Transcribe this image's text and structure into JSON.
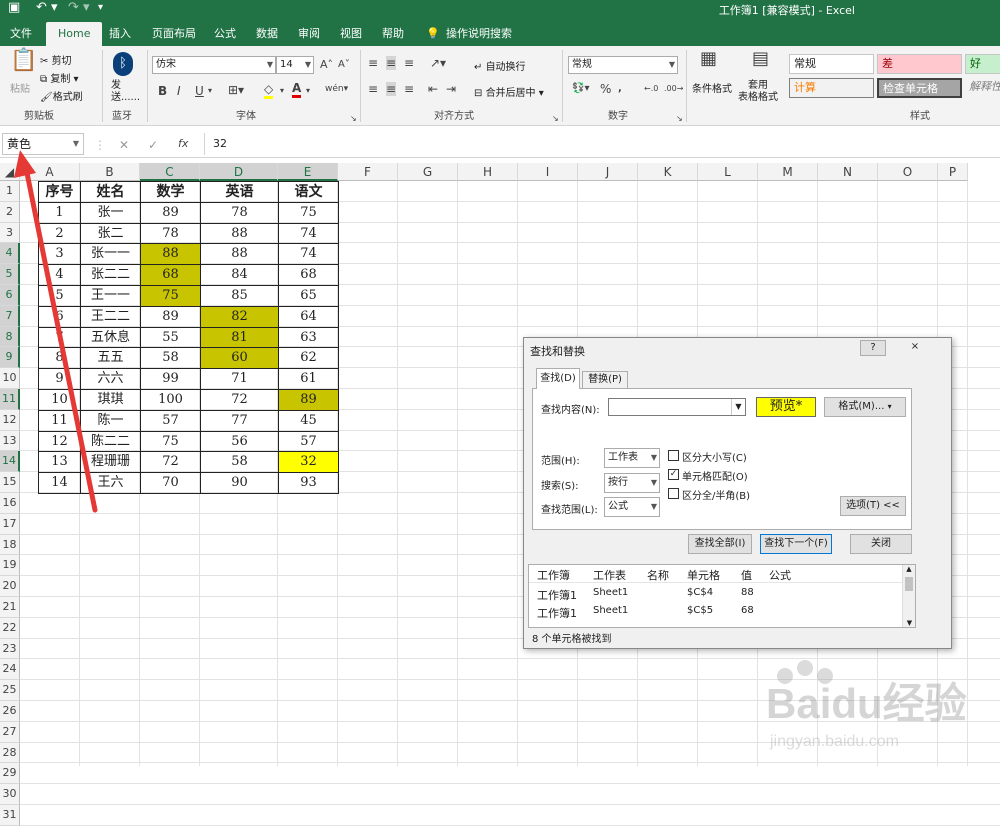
{
  "window": {
    "title": "工作簿1 [兼容模式] - Excel"
  },
  "tabs": [
    "文件",
    "Home",
    "插入",
    "页面布局",
    "公式",
    "数据",
    "审阅",
    "视图",
    "帮助",
    "操作说明搜索"
  ],
  "ribbon": {
    "clipboard": {
      "paste": "粘贴",
      "cut": "剪切",
      "copy": "复制",
      "format_painter": "格式刷",
      "label": "剪贴板"
    },
    "bluetooth": {
      "send": "发送......",
      "label": "蓝牙"
    },
    "font": {
      "name": "仿宋",
      "size": "14",
      "label": "字体"
    },
    "align": {
      "wrap": "自动换行",
      "merge": "合并后居中",
      "label": "对齐方式"
    },
    "number": {
      "format": "常规",
      "label": "数字"
    },
    "styles": {
      "cond": "条件格式",
      "table": "套用\n表格格式",
      "normal": "常规",
      "bad": "差",
      "good": "好",
      "calc": "计算",
      "check": "检查单元格",
      "explain": "解释性",
      "label": "样式"
    }
  },
  "formula_bar": {
    "name_box": "黄色",
    "value": "32"
  },
  "columns": [
    "A",
    "B",
    "C",
    "D",
    "E",
    "F",
    "G",
    "H",
    "I",
    "J",
    "K",
    "L",
    "M",
    "N",
    "O",
    "P"
  ],
  "rows": [
    "1",
    "2",
    "3",
    "4",
    "5",
    "6",
    "7",
    "8",
    "9",
    "10",
    "11",
    "12",
    "13",
    "14",
    "15",
    "16",
    "17",
    "18",
    "19",
    "20",
    "21",
    "22",
    "23",
    "24",
    "25",
    "26",
    "27",
    "28",
    "29",
    "30",
    "31"
  ],
  "table": {
    "headers": [
      "序号",
      "姓名",
      "数学",
      "英语",
      "语文"
    ],
    "rows": [
      [
        "1",
        "张一",
        "89",
        "78",
        "75"
      ],
      [
        "2",
        "张二",
        "78",
        "88",
        "74"
      ],
      [
        "3",
        "张一一",
        "88",
        "88",
        "74"
      ],
      [
        "4",
        "张二二",
        "68",
        "84",
        "68"
      ],
      [
        "5",
        "王一一",
        "75",
        "85",
        "65"
      ],
      [
        "6",
        "王二二",
        "89",
        "82",
        "64"
      ],
      [
        "7",
        "五休息",
        "55",
        "81",
        "63"
      ],
      [
        "8",
        "五五",
        "58",
        "60",
        "62"
      ],
      [
        "9",
        "六六",
        "99",
        "71",
        "61"
      ],
      [
        "10",
        "琪琪",
        "100",
        "72",
        "89"
      ],
      [
        "11",
        "陈一",
        "57",
        "77",
        "45"
      ],
      [
        "12",
        "陈二二",
        "75",
        "56",
        "57"
      ],
      [
        "13",
        "程珊珊",
        "72",
        "58",
        "32"
      ],
      [
        "14",
        "王六",
        "70",
        "90",
        "93"
      ]
    ]
  },
  "dialog": {
    "title": "查找和替换",
    "help": "?",
    "close_x": "×",
    "tab_find": "查找(D)",
    "tab_replace": "替换(P)",
    "find_label": "查找内容(N):",
    "preview": "预览*",
    "format_btn": "格式(M)...",
    "scope_label": "范围(H):",
    "scope_value": "工作表",
    "search_label": "搜索(S):",
    "search_value": "按行",
    "lookin_label": "查找范围(L):",
    "lookin_value": "公式",
    "opt_case": "区分大小写(C)",
    "opt_whole": "单元格匹配(O)",
    "opt_width": "区分全/半角(B)",
    "options_btn": "选项(T) <<",
    "find_all": "查找全部(I)",
    "find_next": "查找下一个(F)",
    "close_btn": "关闭",
    "result_headers": [
      "工作簿",
      "工作表",
      "名称",
      "单元格",
      "值",
      "公式"
    ],
    "results": [
      [
        "工作簿1",
        "Sheet1",
        "",
        "$C$4",
        "88",
        ""
      ],
      [
        "工作簿1",
        "Sheet1",
        "",
        "$C$5",
        "68",
        ""
      ]
    ],
    "status": "8 个单元格被找到"
  },
  "watermark": {
    "brand": "Baidu经验",
    "url": "jingyan.baidu.com"
  }
}
